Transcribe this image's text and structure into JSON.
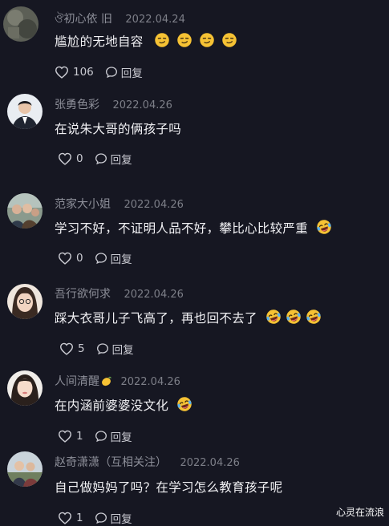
{
  "comments": [
    {
      "author": "ঔ初心依  旧",
      "date": "2022.04.24",
      "text": "尴尬的无地自容",
      "likes": "106",
      "reply_label": "回复",
      "emoji_icon": "smirk-emoji-icon",
      "trailing_emojis": 4,
      "author_emoji": false
    },
    {
      "author": "张勇色彩",
      "date": "2022.04.26",
      "text": "在说朱大哥的俩孩子吗",
      "likes": "0",
      "reply_label": "回复",
      "trailing_emojis": 0
    },
    {
      "author": "范家大小姐",
      "date": "2022.04.26",
      "text": "学习不好，不证明人品不好，攀比心比较严重",
      "likes": "0",
      "reply_label": "回复",
      "emoji_icon": "laugh-cry-emoji-icon",
      "trailing_emojis": 1
    },
    {
      "author": "吾行欲何求",
      "date": "2022.04.26",
      "text": "踩大衣哥儿子飞高了，再也回不去了",
      "likes": "5",
      "reply_label": "回复",
      "emoji_icon": "laugh-cry-emoji-icon",
      "trailing_emojis": 3
    },
    {
      "author": "人间清醒",
      "date": "2022.04.26",
      "text": "在内涵前婆婆没文化",
      "likes": "1",
      "reply_label": "回复",
      "emoji_icon": "laugh-cry-emoji-icon",
      "trailing_emojis": 1,
      "author_emoji_icon": "lemon-emoji-icon"
    },
    {
      "author": "赵奇潇潇（互相关注）",
      "date": "2022.04.26",
      "text": "自己做妈妈了吗？在学习怎么教育孩子呢",
      "likes": "1",
      "reply_label": "回复",
      "trailing_emojis": 0
    }
  ],
  "watermark": "心灵在流浪",
  "colors": {
    "background": "#161722",
    "meta_text": "#8d8f99",
    "body_text": "#f1f1f4",
    "emoji_yellow": "#f6c234"
  }
}
